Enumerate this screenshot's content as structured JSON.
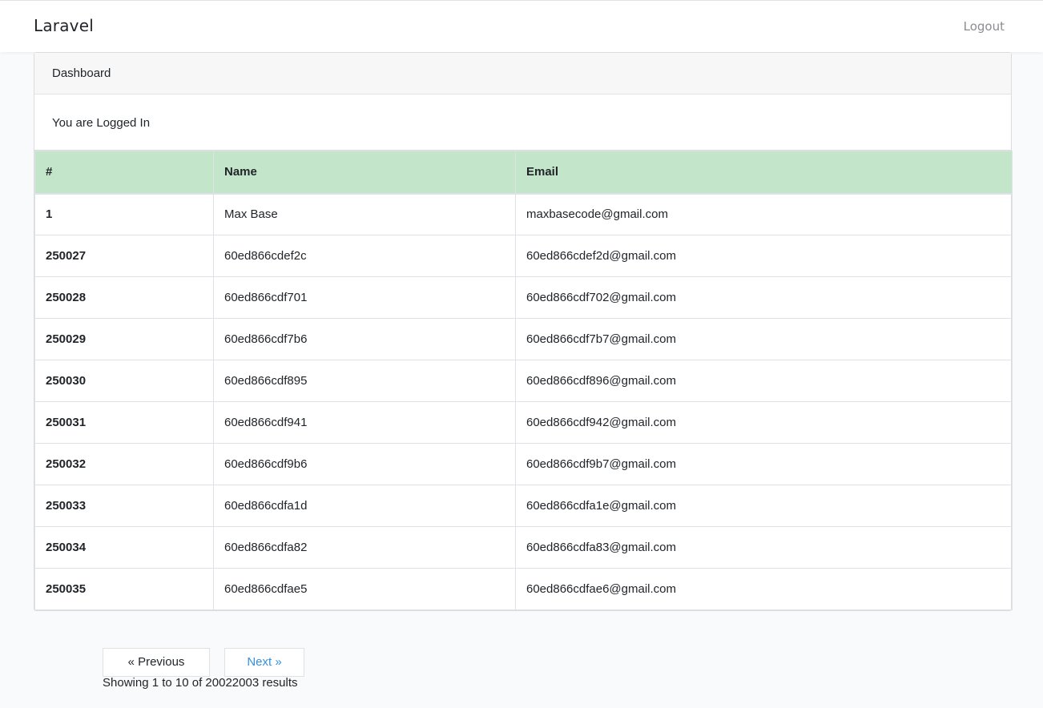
{
  "navbar": {
    "brand": "Laravel",
    "logout_label": "Logout"
  },
  "card": {
    "header": "Dashboard",
    "body": "You are Logged In"
  },
  "table": {
    "headers": [
      "#",
      "Name",
      "Email"
    ],
    "rows": [
      {
        "id": "1",
        "name": "Max Base",
        "email": "maxbasecode@gmail.com"
      },
      {
        "id": "250027",
        "name": "60ed866cdef2c",
        "email": "60ed866cdef2d@gmail.com"
      },
      {
        "id": "250028",
        "name": "60ed866cdf701",
        "email": "60ed866cdf702@gmail.com"
      },
      {
        "id": "250029",
        "name": "60ed866cdf7b6",
        "email": "60ed866cdf7b7@gmail.com"
      },
      {
        "id": "250030",
        "name": "60ed866cdf895",
        "email": "60ed866cdf896@gmail.com"
      },
      {
        "id": "250031",
        "name": "60ed866cdf941",
        "email": "60ed866cdf942@gmail.com"
      },
      {
        "id": "250032",
        "name": "60ed866cdf9b6",
        "email": "60ed866cdf9b7@gmail.com"
      },
      {
        "id": "250033",
        "name": "60ed866cdfa1d",
        "email": "60ed866cdfa1e@gmail.com"
      },
      {
        "id": "250034",
        "name": "60ed866cdfa82",
        "email": "60ed866cdfa83@gmail.com"
      },
      {
        "id": "250035",
        "name": "60ed866cdfae5",
        "email": "60ed866cdfae6@gmail.com"
      }
    ]
  },
  "pagination": {
    "previous_label": "« Previous",
    "next_label": "Next »",
    "results_text": "Showing 1 to 10 of 20022003 results"
  },
  "colors": {
    "header_row_bg": "#c3e6cb",
    "link": "#3490dc"
  }
}
